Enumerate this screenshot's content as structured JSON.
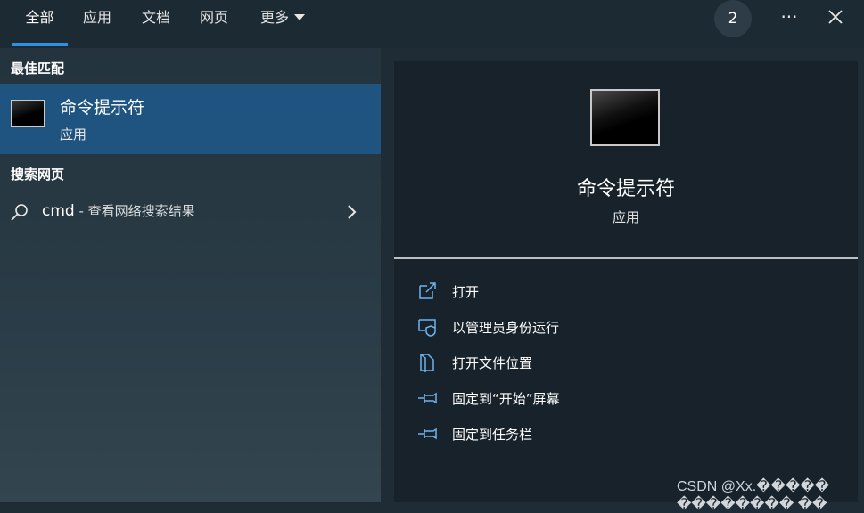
{
  "tabs": [
    {
      "label": "全部",
      "active": true
    },
    {
      "label": "应用"
    },
    {
      "label": "文档"
    },
    {
      "label": "网页"
    },
    {
      "label": "更多"
    }
  ],
  "header": {
    "badge_count": "2",
    "more_options_icon": "ellipsis-icon",
    "close_icon": "close-icon"
  },
  "left": {
    "best_match_title": "最佳匹配",
    "best_match": {
      "name": "命令提示符",
      "type": "应用",
      "icon": "command-prompt-icon"
    },
    "web_search_title": "搜索网页",
    "web_search": {
      "query": "cmd",
      "suffix": " - 查看网络搜索结果",
      "icon": "search-icon",
      "chevron": "chevron-right-icon"
    }
  },
  "right": {
    "app_name": "命令提示符",
    "app_type": "应用",
    "actions": [
      {
        "label": "打开",
        "icon": "open-external-icon"
      },
      {
        "label": "以管理员身份运行",
        "icon": "shield-admin-icon"
      },
      {
        "label": "打开文件位置",
        "icon": "folder-location-icon"
      },
      {
        "label": "固定到“开始”屏幕",
        "icon": "pin-icon"
      },
      {
        "label": "固定到任务栏",
        "icon": "pin-icon"
      }
    ]
  },
  "watermark": "CSDN @Xx.����� �������� ��",
  "colors": {
    "accent": "#2f8fe0",
    "selected": "#1f5380",
    "icon_blue": "#6fb3ef"
  }
}
